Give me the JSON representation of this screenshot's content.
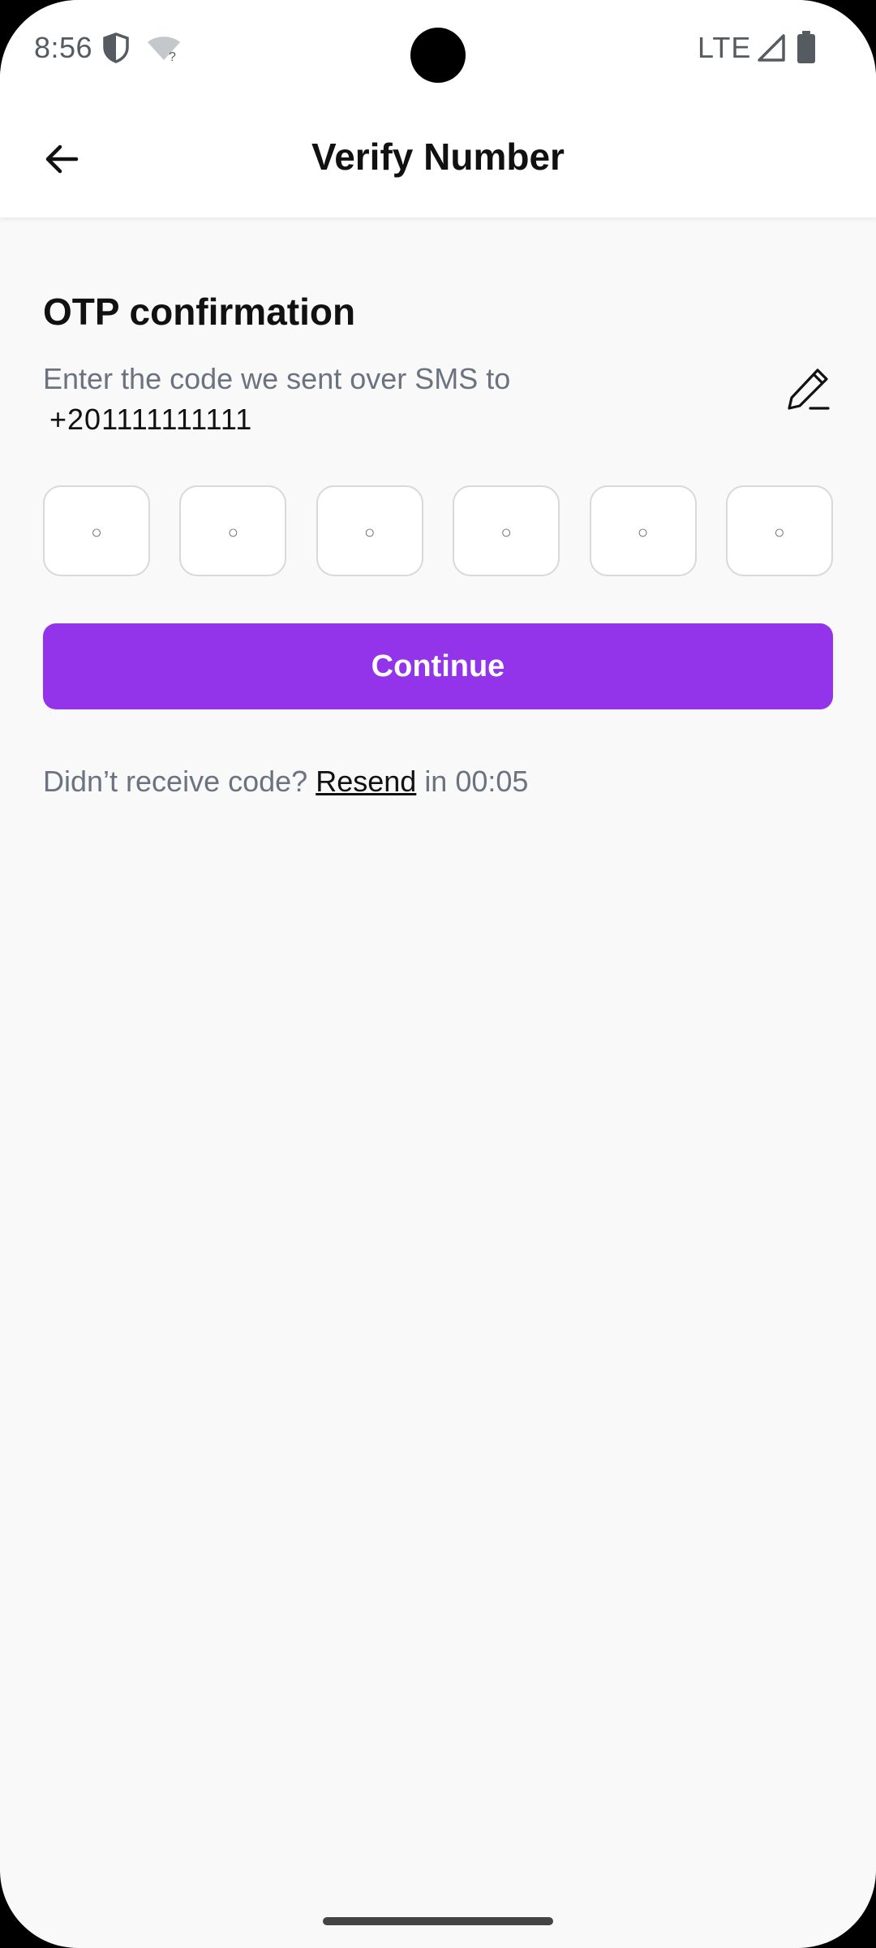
{
  "status_bar": {
    "time": "8:56",
    "network": "LTE",
    "wifi_badge": "?"
  },
  "app_bar": {
    "title": "Verify Number"
  },
  "otp": {
    "heading": "OTP confirmation",
    "instruction": "Enter the code we sent over SMS to",
    "phone_number": "+201111111111",
    "digits": [
      "◦",
      "◦",
      "◦",
      "◦",
      "◦",
      "◦"
    ],
    "continue_label": "Continue",
    "resend_prefix": "Didn’t receive code?",
    "resend_label": "Resend",
    "resend_suffix": "in 00:05"
  },
  "colors": {
    "accent": "#9333ea",
    "background": "#f9f9f9",
    "muted_text": "#6b7280"
  },
  "icons": {
    "back": "arrow-left-icon",
    "edit": "pencil-icon",
    "shield": "shield-icon",
    "wifi": "wifi-icon",
    "signal": "signal-icon",
    "battery": "battery-icon"
  }
}
